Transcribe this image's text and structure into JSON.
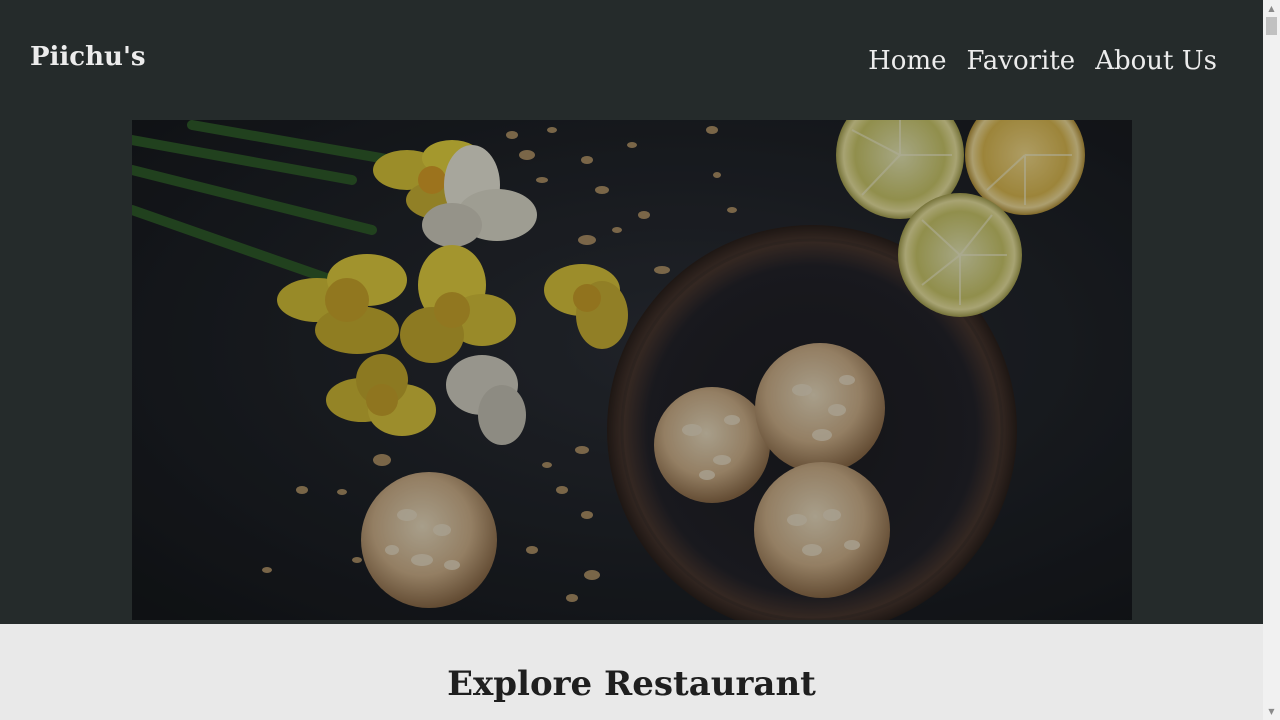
{
  "header": {
    "brand": "Piichu's",
    "nav": [
      {
        "label": "Home"
      },
      {
        "label": "Favorite"
      },
      {
        "label": "About Us"
      }
    ]
  },
  "hero": {
    "image": "hero-food-photo"
  },
  "main": {
    "title": "Explore Restaurant"
  },
  "scrollbar": {
    "up_icon": "▲",
    "down_icon": "▼"
  },
  "colors": {
    "header_bg": "#252b2b",
    "content_bg": "#e9e9e9",
    "text_light": "#ececec",
    "text_dark": "#1f1f1f"
  }
}
